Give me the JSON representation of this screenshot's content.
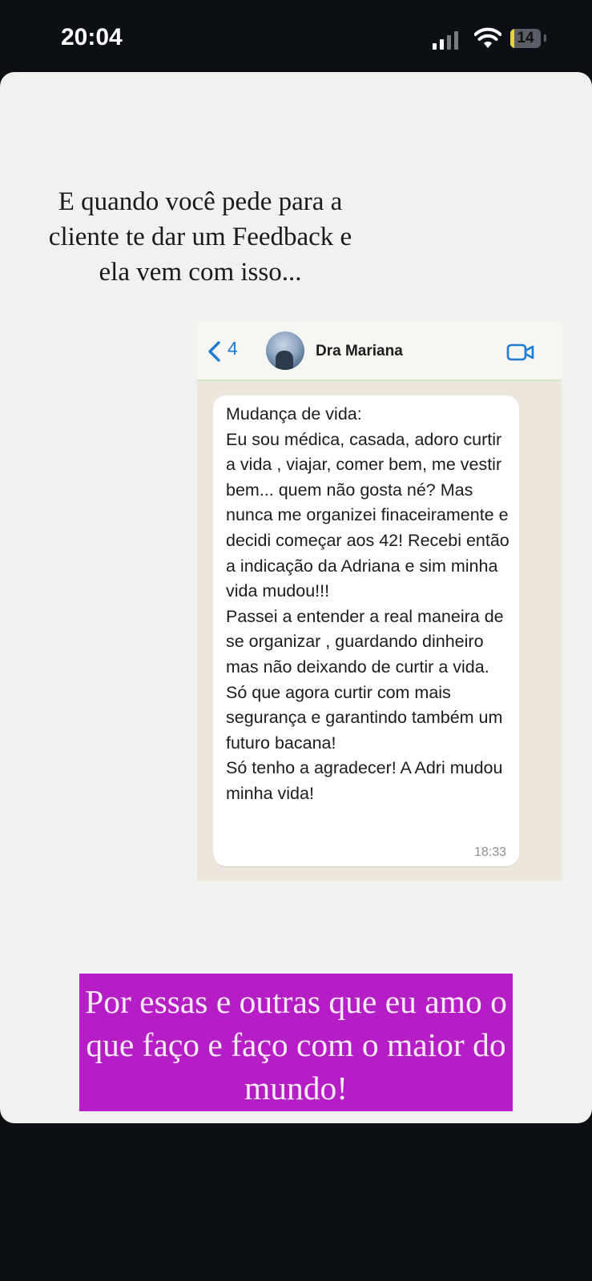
{
  "status_bar": {
    "time": "20:04",
    "battery": "14",
    "battery_level": 0.14
  },
  "story": {
    "headline": "E quando você pede para a cliente te dar um Feedback e ela vem com isso...",
    "highlight_text": "Por essas e outras que eu amo o que faço e faço com o maior do mundo!",
    "highlight_color": "#b51ec4"
  },
  "chat": {
    "back_count": "4",
    "contact_name": "Dra Mariana",
    "message": "Mudança de vida:\nEu sou médica, casada, adoro curtir a vida , viajar, comer bem, me vestir bem... quem não gosta né? Mas nunca me organizei finaceiramente e decidi começar aos 42! Recebi então a indicação da Adriana e sim minha vida mudou!!!\nPassei a entender a real maneira de se organizar , guardando dinheiro mas não deixando de curtir a vida. Só que agora curtir com mais segurança e garantindo também um futuro bacana!\nSó tenho a agradecer! A Adri mudou minha vida!",
    "time": "18:33",
    "accent_color": "#1f7cd1"
  },
  "icons": [
    "signal-icon",
    "wifi-icon",
    "battery-icon",
    "back-chevron-icon",
    "video-call-icon"
  ]
}
